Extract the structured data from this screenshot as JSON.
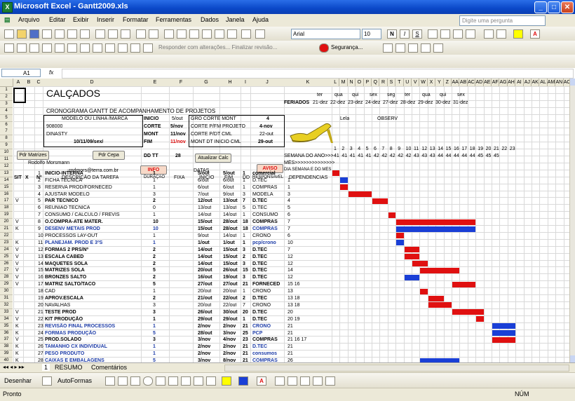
{
  "app": {
    "title": "Microsoft Excel - Gantt2009.xls",
    "icon_letter": "X"
  },
  "window_buttons": {
    "min": "_",
    "max": "□",
    "close": "✕"
  },
  "menu": [
    "Arquivo",
    "Editar",
    "Exibir",
    "Inserir",
    "Formatar",
    "Ferramentas",
    "Dados",
    "Janela",
    "Ajuda"
  ],
  "help_placeholder": "Digite uma pergunta",
  "toolbar": {
    "font_name": "Arial",
    "font_size": "10",
    "review_text": "Responder com alterações...  Finalizar revisão...",
    "security_label": "Segurança..."
  },
  "formula": {
    "cell_ref": "A1",
    "fx": "fx"
  },
  "sheet": {
    "columns": [
      "A",
      "B",
      "C",
      "D",
      "E",
      "F",
      "G",
      "H",
      "I",
      "J",
      "K",
      "L",
      "M",
      "N",
      "O",
      "P",
      "Q",
      "R",
      "S",
      "T",
      "U",
      "V",
      "W",
      "X",
      "Y",
      "Z",
      "AA",
      "AB",
      "AC",
      "AD",
      "AE",
      "AF",
      "AG",
      "AH",
      "AI",
      "AJ",
      "AK",
      "AL",
      "AM",
      "AN",
      "AO"
    ],
    "header": {
      "title": "CALÇADOS",
      "subtitle": "CRONOGRAMA GANTT DE ACOMPANHAMENTO DE PROJETOS",
      "modelo_label": "MODELO OU LINHA /MARCA",
      "modelo": "908000",
      "marca": "DINASTY",
      "date_ref": "10/11/09/sex/",
      "inicio_label": "INICIO",
      "inicio_val": "5/out",
      "corte_label": "CORTE",
      "corte_val": "5/nov",
      "mont_label": "MONT",
      "mont_val": "11/nov",
      "fim_label": "FIM",
      "fim_val": "11/nov",
      "dd_label": "DD TT",
      "dd_val": "28",
      "gro_label": "GRO CORTE MONT",
      "gro_val": "4",
      "corte_pfm": "CORTE P/FM PROJETO",
      "corte_pfm_val": "4-nov",
      "corte_pdt": "CORTE P/DT CML",
      "corte_pdt_val": "22-out",
      "mont_dt": "MONT DT INICIO CML",
      "mont_dt_val": "29-out",
      "lela": "Lela",
      "obs": "OBSERV",
      "person": "Rodolfo Morsmann",
      "email": "-rodmors@terra.com.br",
      "feriados": "FERIADOS",
      "semana": "SEMANA DO ANO>>>",
      "mes": "MÊS>>>>>>>>>>>>>>",
      "dia_semana": "DIA SEMANA E DO MÊS"
    },
    "buttons": {
      "pdr_matrizes": "Pdr Matrizes",
      "pdr_cepa": "Pdr Cepa",
      "atualizar": "Atualizar Calc",
      "info": "INFO",
      "aviso": "AVISO",
      "datas": "DATAS"
    },
    "holiday_days": [
      "ter",
      "qua",
      "qui",
      "sex",
      "seg",
      "ter",
      "qua",
      "qui",
      "sex"
    ],
    "holiday_dates": [
      "21-dez",
      "22-dez",
      "23-dez",
      "24-dez",
      "27-dez",
      "28-dez",
      "29-dez",
      "30-dez",
      "31-dez"
    ],
    "week_numbers": [
      "41",
      "41",
      "41",
      "41",
      "41",
      "42",
      "42",
      "42",
      "42",
      "42",
      "43",
      "43",
      "43",
      "44",
      "44",
      "44",
      "44",
      "44",
      "45",
      "45",
      "45"
    ],
    "day_numbers": [
      "1",
      "2",
      "3",
      "4",
      "5",
      "6",
      "7",
      "8",
      "9",
      "10",
      "11",
      "12",
      "13",
      "14",
      "15",
      "16",
      "17",
      "18",
      "19",
      "20",
      "21",
      "22",
      "23"
    ],
    "table_headers": {
      "sit": "SIT",
      "x": "X",
      "n": "Nº",
      "descr": "DESCRIÇÃO DA TAREFA",
      "duracao": "DURAÇÃO",
      "fixa": "FIXA",
      "inicio": "INICIO",
      "fim": "FIM",
      "dd": "DD",
      "resp": "RESPONSAVEL",
      "dep": "DEPENDENCIAS"
    },
    "tasks": [
      {
        "row": "13",
        "sit": "",
        "x": "",
        "n": "1",
        "descr": "INICIO-INTERNA",
        "dur": "1",
        "ini": "5/out",
        "fim": "5/out",
        "dd": "1",
        "resp": "comercial",
        "dep": "",
        "bold": true,
        "bars": [
          {
            "s": 0,
            "l": 1,
            "c": "red"
          }
        ]
      },
      {
        "row": "14",
        "sit": "",
        "x": "",
        "n": "2",
        "descr": "FICHA TECNICA",
        "dur": "1",
        "ini": "6/out",
        "fim": "6/out",
        "dd": "1",
        "resp": "D.TEC",
        "dep": "1",
        "bars": [
          {
            "s": 1,
            "l": 1,
            "c": "blue"
          }
        ]
      },
      {
        "row": "15",
        "sit": "",
        "x": "",
        "n": "3",
        "descr": "RESERVA PROD/FORNECED",
        "dur": "1",
        "ini": "6/out",
        "fim": "6/out",
        "dd": "1",
        "resp": "COMPRAS",
        "dep": "1",
        "bars": [
          {
            "s": 1,
            "l": 1,
            "c": "red"
          }
        ]
      },
      {
        "row": "16",
        "sit": "",
        "x": "",
        "n": "4",
        "descr": "AJUSTAR MODELO",
        "dur": "3",
        "ini": "7/out",
        "fim": "9/out",
        "dd": "3",
        "resp": "MODELA",
        "dep": "3",
        "bars": [
          {
            "s": 2,
            "l": 3,
            "c": "red"
          }
        ]
      },
      {
        "row": "17",
        "sit": "V",
        "x": "",
        "n": "5",
        "descr": "PAR TECNICO",
        "dur": "2",
        "ini": "12/out",
        "fim": "13/out",
        "dd": "7",
        "resp": "D.TEC",
        "dep": "4",
        "bold": true,
        "bars": [
          {
            "s": 5,
            "l": 2,
            "c": "red"
          }
        ]
      },
      {
        "row": "18",
        "sit": "",
        "x": "",
        "n": "6",
        "descr": "REUNIAO TECNICA",
        "dur": "0",
        "ini": "13/out",
        "fim": "13/out",
        "dd": "5",
        "resp": "D.TEC",
        "dep": "5",
        "bars": []
      },
      {
        "row": "19",
        "sit": "",
        "x": "",
        "n": "7",
        "descr": "CONSUMO / CALCULO / FREVIS",
        "dur": "1",
        "ini": "14/out",
        "fim": "14/out",
        "dd": "1",
        "resp": "CONSUMO",
        "dep": "6",
        "bars": [
          {
            "s": 7,
            "l": 1,
            "c": "red"
          }
        ]
      },
      {
        "row": "20",
        "sit": "V",
        "x": "",
        "n": "8",
        "descr": "O.COMPRA-ATE MATER.",
        "dur": "10",
        "ini": "15/out",
        "fim": "28/out",
        "dd": "18",
        "resp": "COMPRAS",
        "dep": "7",
        "bold": true,
        "bars": [
          {
            "s": 8,
            "l": 10,
            "c": "red"
          }
        ]
      },
      {
        "row": "21",
        "sit": "K",
        "x": "",
        "n": "9",
        "descr": "DESENV METAIS PROD",
        "dur": "10",
        "ini": "15/out",
        "fim": "28/out",
        "dd": "18",
        "resp": "COMPRAS",
        "dep": "7",
        "bold": true,
        "blue": true,
        "bars": [
          {
            "s": 8,
            "l": 10,
            "c": "blue"
          }
        ]
      },
      {
        "row": "22",
        "sit": "",
        "x": "",
        "n": "10",
        "descr": "PROCESSOS LAY-OUT",
        "dur": "1",
        "ini": "9/out",
        "fim": "14/out",
        "dd": "1",
        "resp": "CRONO",
        "dep": "6",
        "bars": [
          {
            "s": 8,
            "l": 1,
            "c": "red"
          }
        ]
      },
      {
        "row": "23",
        "sit": "K",
        "x": "",
        "n": "11",
        "descr": "PLANEJAM. PROD E 3ºS",
        "dur": "1",
        "ini": "1/out",
        "fim": "1/out",
        "dd": "1",
        "resp": "pcp/crono",
        "dep": "10",
        "bold": true,
        "blue": true,
        "bars": [
          {
            "s": 8,
            "l": 1,
            "c": "blue"
          }
        ]
      },
      {
        "row": "24",
        "sit": "V",
        "x": "",
        "n": "12",
        "descr": "FORMAS 2 PRS/Nº",
        "dur": "2",
        "ini": "14/out",
        "fim": "15/out",
        "dd": "3",
        "resp": "D.TEC",
        "dep": "7",
        "bold": true,
        "bars": [
          {
            "s": 9,
            "l": 2,
            "c": "red"
          }
        ]
      },
      {
        "row": "25",
        "sit": "V",
        "x": "",
        "n": "13",
        "descr": "ESCALA CABED",
        "dur": "2",
        "ini": "14/out",
        "fim": "15/out",
        "dd": "2",
        "resp": "D.TEC",
        "dep": "12",
        "bold": true,
        "bars": [
          {
            "s": 9,
            "l": 2,
            "c": "red"
          }
        ]
      },
      {
        "row": "26",
        "sit": "V",
        "x": "",
        "n": "14",
        "descr": "MAQUETES SOLA",
        "dur": "2",
        "ini": "14/out",
        "fim": "15/out",
        "dd": "3",
        "resp": "D.TEC",
        "dep": "12",
        "bold": true,
        "bars": [
          {
            "s": 10,
            "l": 2,
            "c": "red"
          }
        ]
      },
      {
        "row": "27",
        "sit": "V",
        "x": "",
        "n": "15",
        "descr": "MATRIZES SOLA",
        "dur": "5",
        "ini": "20/out",
        "fim": "26/out",
        "dd": "15",
        "resp": "D.TEC",
        "dep": "14",
        "bold": true,
        "bars": [
          {
            "s": 11,
            "l": 5,
            "c": "red"
          }
        ]
      },
      {
        "row": "28",
        "sit": "V",
        "x": "",
        "n": "16",
        "descr": "BRONZES SALTO",
        "dur": "2",
        "ini": "16/out",
        "fim": "19/out",
        "dd": "3",
        "resp": "D.TEC",
        "dep": "12",
        "bold": true,
        "bars": [
          {
            "s": 9,
            "l": 2,
            "c": "blue"
          }
        ]
      },
      {
        "row": "29",
        "sit": "V",
        "x": "",
        "n": "17",
        "descr": "MATRIZ SALTO/TACO",
        "dur": "5",
        "ini": "27/out",
        "fim": "27/out",
        "dd": "21",
        "resp": "FORNECED",
        "dep": "15  16",
        "bold": true,
        "bars": [
          {
            "s": 15,
            "l": 3,
            "c": "red"
          }
        ]
      },
      {
        "row": "30",
        "sit": "",
        "x": "",
        "n": "18",
        "descr": "CAD",
        "dur": "1",
        "ini": "20/out",
        "fim": "20/out",
        "dd": "1",
        "resp": "CRONO",
        "dep": "13",
        "bars": [
          {
            "s": 11,
            "l": 1,
            "c": "red"
          }
        ]
      },
      {
        "row": "31",
        "sit": "",
        "x": "",
        "n": "19",
        "descr": "APROV.ESCALA",
        "dur": "2",
        "ini": "21/out",
        "fim": "22/out",
        "dd": "2",
        "resp": "D.TEC",
        "dep": "13  18",
        "bold": true,
        "bars": [
          {
            "s": 12,
            "l": 2,
            "c": "red"
          }
        ]
      },
      {
        "row": "32",
        "sit": "",
        "x": "",
        "n": "20",
        "descr": "NAVALHAS",
        "dur": "3",
        "ini": "20/out",
        "fim": "22/out",
        "dd": "7",
        "resp": "CRONO",
        "dep": "13  18",
        "bars": [
          {
            "s": 12,
            "l": 3,
            "c": "red"
          }
        ]
      },
      {
        "row": "33",
        "sit": "V",
        "x": "",
        "n": "21",
        "descr": "TESTE PROD",
        "dur": "3",
        "ini": "26/out",
        "fim": "30/out",
        "dd": "20",
        "resp": "D.TEC",
        "dep": "20",
        "bold": true,
        "bars": [
          {
            "s": 15,
            "l": 4,
            "c": "red"
          }
        ]
      },
      {
        "row": "34",
        "sit": "V",
        "x": "",
        "n": "22",
        "descr": "KIT PRODUÇÃO",
        "dur": "1",
        "ini": "29/out",
        "fim": "29/out",
        "dd": "1",
        "resp": "D.TEC",
        "dep": "20  19",
        "bold": true,
        "bars": [
          {
            "s": 18,
            "l": 1,
            "c": "red"
          }
        ]
      },
      {
        "row": "35",
        "sit": "K",
        "x": "",
        "n": "23",
        "descr": "REVISÃO FINAL PROCESSOS",
        "dur": "1",
        "ini": "2/nov",
        "fim": "2/nov",
        "dd": "21",
        "resp": "CRONO",
        "dep": "21",
        "bold": true,
        "blue": true,
        "bars": [
          {
            "s": 20,
            "l": 3,
            "c": "blue"
          }
        ]
      },
      {
        "row": "36",
        "sit": "K",
        "x": "",
        "n": "24",
        "descr": "FORMAS PRODUÇÃO",
        "dur": "5",
        "ini": "28/out",
        "fim": "3/nov",
        "dd": "25",
        "resp": "PCP",
        "dep": "21",
        "bold": true,
        "blue": true,
        "bars": [
          {
            "s": 20,
            "l": 3,
            "c": "blue"
          }
        ]
      },
      {
        "row": "37",
        "sit": "V",
        "x": "",
        "n": "25",
        "descr": "PROD.SOLADO",
        "dur": "3",
        "ini": "3/nov",
        "fim": "4/nov",
        "dd": "23",
        "resp": "COMPRAS",
        "dep": "21  16  17",
        "bold": true,
        "bars": [
          {
            "s": 20,
            "l": 3,
            "c": "red"
          }
        ]
      },
      {
        "row": "38",
        "sit": "K",
        "x": "",
        "n": "26",
        "descr": "TAMANHO CX INDIVIDUAL",
        "dur": "1",
        "ini": "2/nov",
        "fim": "2/nov",
        "dd": "21",
        "resp": "D.TEC",
        "dep": "21",
        "bold": true,
        "blue": true,
        "bars": []
      },
      {
        "row": "39",
        "sit": "K",
        "x": "",
        "n": "27",
        "descr": "PESO PRODUTO",
        "dur": "1",
        "ini": "2/nov",
        "fim": "2/nov",
        "dd": "21",
        "resp": "consumos",
        "dep": "21",
        "bold": true,
        "blue": true,
        "bars": []
      },
      {
        "row": "40",
        "sit": "K",
        "x": "",
        "n": "28",
        "descr": "CAIXAS E EMBALAGENS",
        "dur": "5",
        "ini": "3/nov",
        "fim": "8/nov",
        "dd": "21",
        "resp": "COMPRAS",
        "dep": "26",
        "bold": true,
        "blue": true,
        "bars": [
          {
            "s": 11,
            "l": 5,
            "c": "blue"
          }
        ]
      }
    ]
  },
  "sheet_tabs": [
    "1",
    "RESUMO",
    "Comentários"
  ],
  "draw_toolbar": {
    "desenhar": "Desenhar",
    "autoformas": "AutoFormas"
  },
  "status": {
    "left": "Pronto",
    "num": "NÚM"
  },
  "colors": {
    "red": "#e01010",
    "blue": "#1a3fd6",
    "title_blue": "#0a48c8"
  }
}
